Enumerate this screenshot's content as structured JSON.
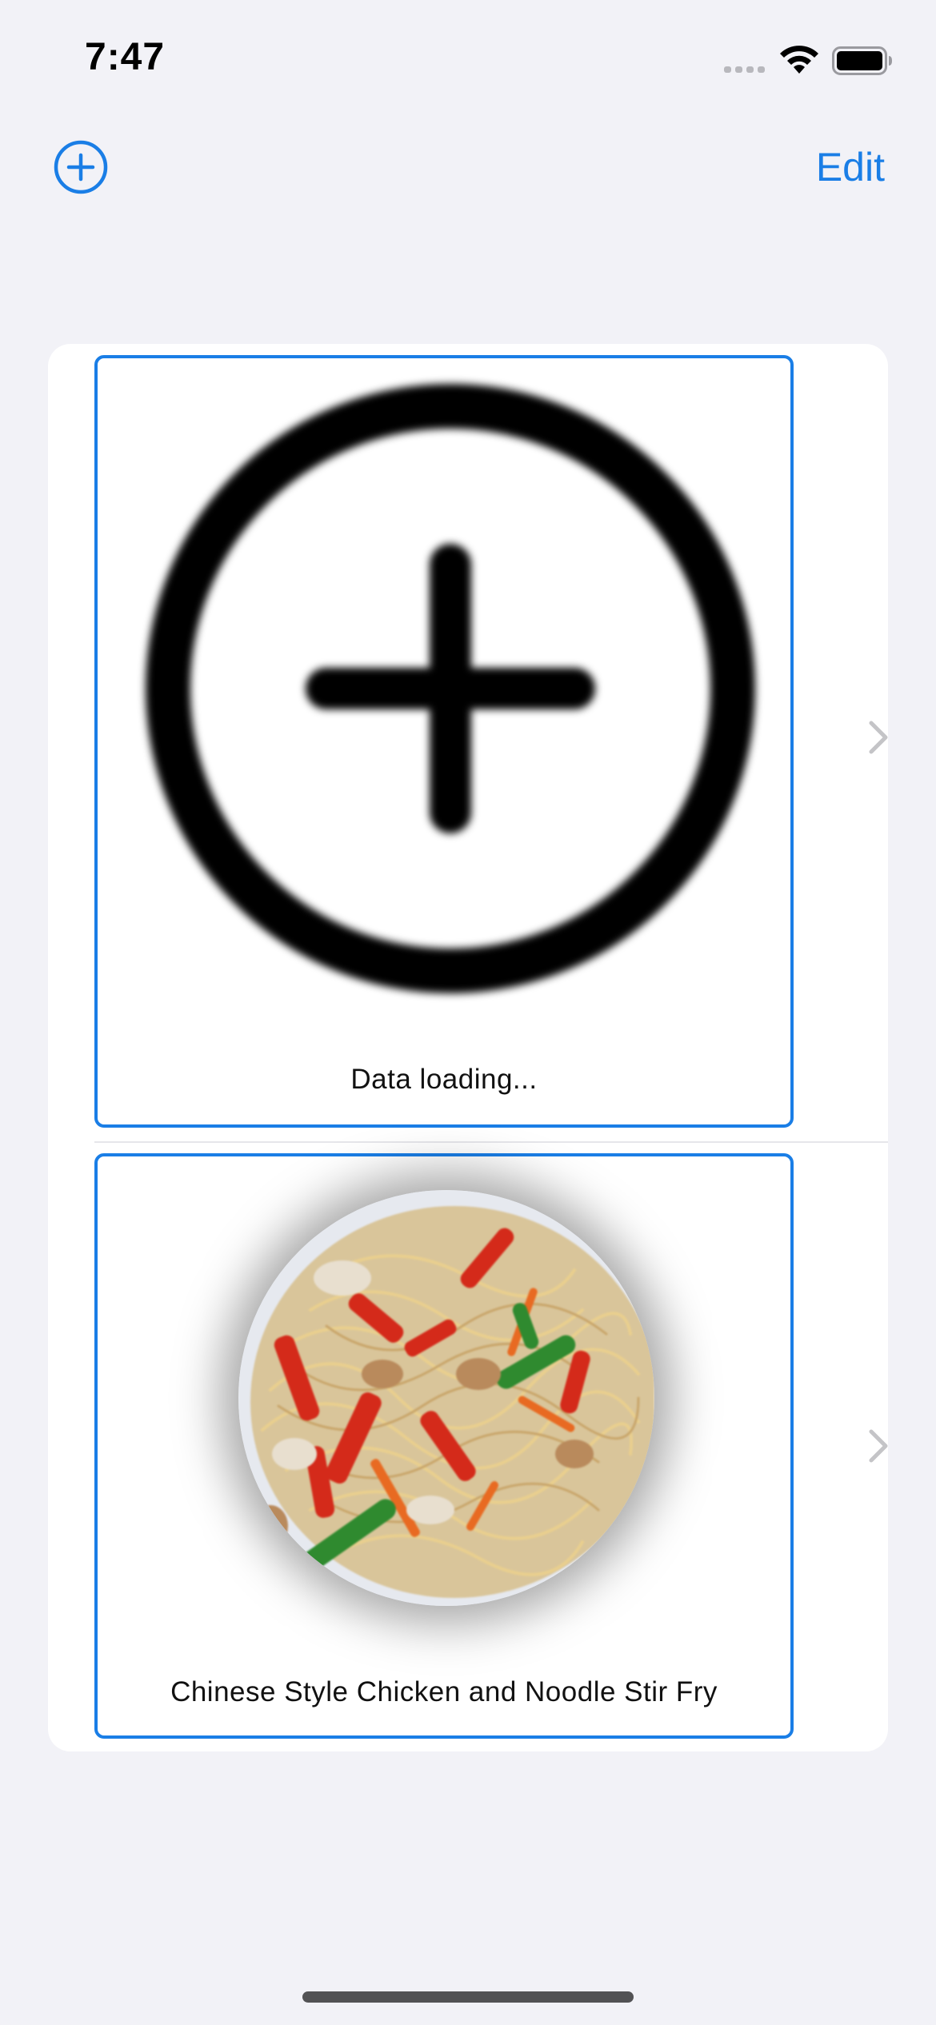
{
  "status_bar": {
    "time": "7:47",
    "icons": [
      "cellular-signal-icon",
      "wifi-icon",
      "battery-icon"
    ]
  },
  "nav_bar": {
    "add_icon": "plus-circle-icon",
    "edit_label": "Edit"
  },
  "list": {
    "items": [
      {
        "caption": "Data loading...",
        "image": "plus-circle-placeholder-icon"
      },
      {
        "caption": "Chinese Style Chicken and Noodle Stir Fry",
        "image": "chicken-noodle-stir-fry-photo"
      }
    ]
  },
  "colors": {
    "accent": "#1a7ee6",
    "background": "#f2f2f7",
    "card": "#ffffff",
    "chevron": "#c4c4c7"
  }
}
